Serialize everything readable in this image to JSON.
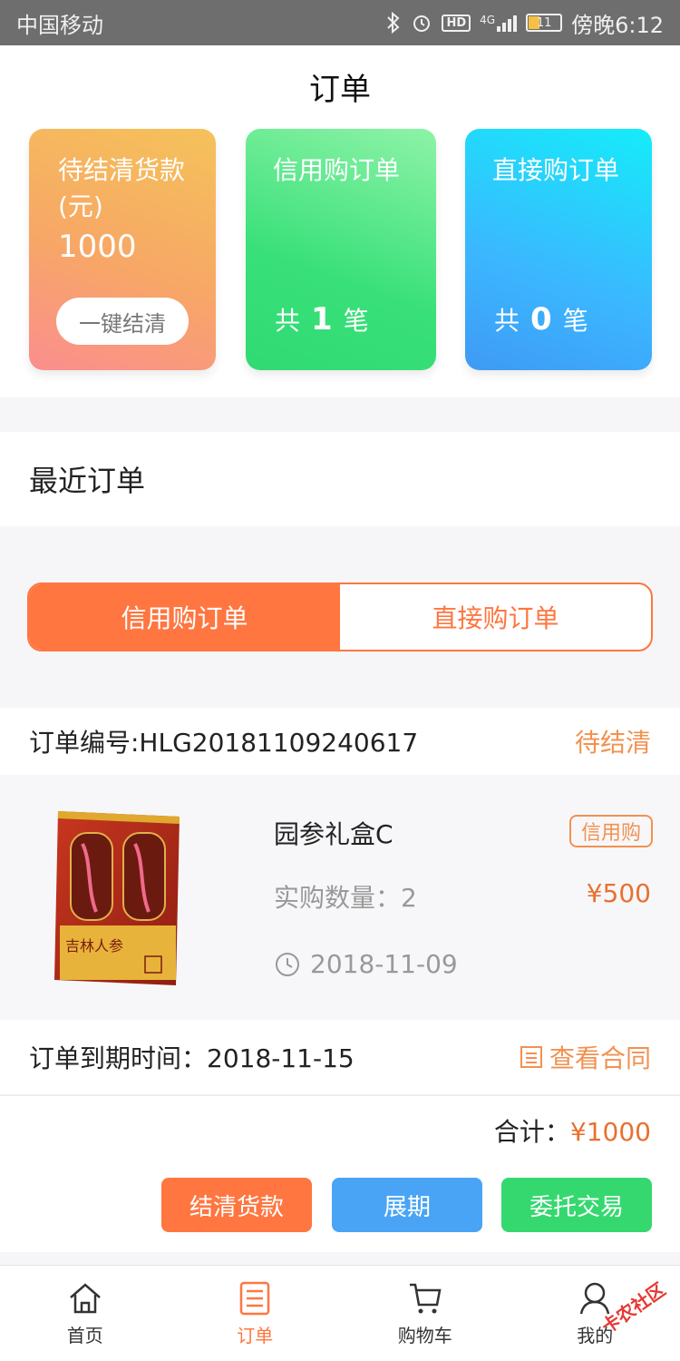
{
  "status_bar": {
    "carrier": "中国移动",
    "hd": "HD",
    "network": "4G",
    "battery": "11",
    "time": "傍晚6:12"
  },
  "header": {
    "title": "订单"
  },
  "summary": {
    "pending": {
      "title": "待结清货款(元)",
      "amount": "1000",
      "button": "一键结清"
    },
    "credit": {
      "title": "信用购订单",
      "prefix": "共",
      "count": "1",
      "suffix": "笔"
    },
    "direct": {
      "title": "直接购订单",
      "prefix": "共",
      "count": "0",
      "suffix": "笔"
    }
  },
  "recent": {
    "title": "最近订单"
  },
  "segment": {
    "tabs": [
      {
        "label": "信用购订单",
        "active": true
      },
      {
        "label": "直接购订单",
        "active": false
      }
    ]
  },
  "order": {
    "number": "订单编号:HLG20181109240617",
    "status": "待结清",
    "product_name": "园参礼盒C",
    "tag": "信用购",
    "quantity": "实购数量：2",
    "price": "¥500",
    "date": "2018-11-09",
    "due": "订单到期时间：2018-11-15",
    "contract": "查看合同",
    "total_label": "合计：",
    "total_amount": "¥1000",
    "actions": {
      "settle": "结清货款",
      "extend": "展期",
      "entrust": "委托交易"
    },
    "box_text": "吉林人参"
  },
  "tabbar": {
    "items": [
      {
        "label": "首页"
      },
      {
        "label": "订单"
      },
      {
        "label": "购物车"
      },
      {
        "label": "我的"
      }
    ]
  },
  "watermark": "卡农社区",
  "colors": {
    "accent": "#ff7640",
    "blue": "#4aa4f5",
    "green": "#35d86f",
    "orange_text": "#f29150"
  }
}
